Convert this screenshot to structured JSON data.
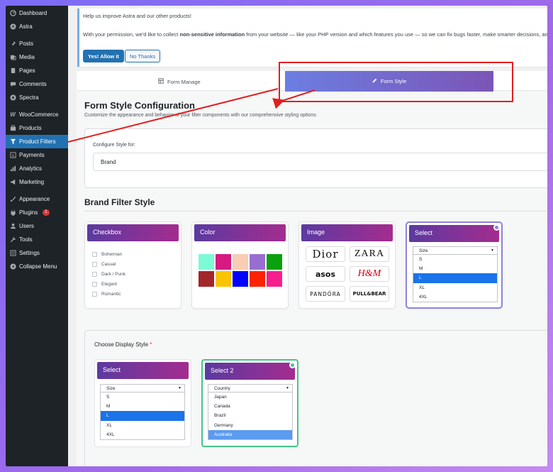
{
  "sidebar": {
    "items": [
      {
        "label": "Dashboard",
        "icon": "dashboard-icon"
      },
      {
        "label": "Astra",
        "icon": "astra-icon"
      },
      {
        "label": "Posts",
        "icon": "pin-icon"
      },
      {
        "label": "Media",
        "icon": "media-icon"
      },
      {
        "label": "Pages",
        "icon": "pages-icon"
      },
      {
        "label": "Comments",
        "icon": "comments-icon"
      },
      {
        "label": "Spectra",
        "icon": "spectra-icon"
      },
      {
        "label": "WooCommerce",
        "icon": "woocommerce-icon"
      },
      {
        "label": "Products",
        "icon": "products-icon"
      },
      {
        "label": "Product Filters",
        "icon": "filter-icon"
      },
      {
        "label": "Payments",
        "icon": "payments-icon"
      },
      {
        "label": "Analytics",
        "icon": "analytics-icon"
      },
      {
        "label": "Marketing",
        "icon": "marketing-icon"
      },
      {
        "label": "Appearance",
        "icon": "appearance-icon"
      },
      {
        "label": "Plugins",
        "icon": "plugins-icon",
        "badge": "1"
      },
      {
        "label": "Users",
        "icon": "users-icon"
      },
      {
        "label": "Tools",
        "icon": "tools-icon"
      },
      {
        "label": "Settings",
        "icon": "settings-icon"
      },
      {
        "label": "Collapse Menu",
        "icon": "collapse-icon"
      }
    ]
  },
  "notice": {
    "title": "Help us improve Astra and our other products!",
    "body_pre": "With your permission, we'd like to collect ",
    "body_bold": "non-sensitive information",
    "body_post": " from your website — like your PHP version and which features you use — so we can fix bugs faster, make smarter decisions, and build feat",
    "allow_label": "Yes! Allow it",
    "decline_label": "No Thanks"
  },
  "tabs": {
    "manage": "Form Manage",
    "style": "Form Style"
  },
  "config": {
    "title": "Form Style Configuration",
    "subtitle": "Customize the appearance and behavior of your filter components with our comprehensive styling options",
    "label": "Configure Style for:",
    "selected": "Brand"
  },
  "brand_section": {
    "title": "Brand Filter Style",
    "cards": {
      "checkbox": {
        "title": "Checkbox",
        "options": [
          "Bohemian",
          "Casual",
          "Dark / Punk",
          "Elegant",
          "Romantic"
        ]
      },
      "color": {
        "title": "Color",
        "swatches": [
          "#7dfad6",
          "#d61a7f",
          "#f9cdb4",
          "#9a6dd1",
          "#0aa10f",
          "#a3262a",
          "#fbc400",
          "#0000ff",
          "#ff2400",
          "#f71f8e"
        ]
      },
      "image": {
        "title": "Image",
        "brands": [
          "Dior",
          "ZARA",
          "asos",
          "H&M",
          "PANDÖRA",
          "PULL&BEAR"
        ]
      },
      "select": {
        "title": "Select",
        "header": "Size",
        "options": [
          "S",
          "M",
          "L",
          "XL",
          "4XL"
        ],
        "selected": "L"
      }
    }
  },
  "display": {
    "label": "Choose Display Style",
    "required": "*",
    "select": {
      "title": "Select",
      "header": "Size",
      "options": [
        "S",
        "M",
        "L",
        "XL",
        "4XL"
      ],
      "selected": "L"
    },
    "select2": {
      "title": "Select 2",
      "header": "Country",
      "options": [
        "Japan",
        "Canada",
        "Brazil",
        "Germany",
        "Australia"
      ],
      "selected": "Australia"
    }
  },
  "colors": {
    "sidebar_bg": "#1d2327",
    "wp_blue": "#2271b1",
    "annotation_red": "#e02020",
    "selected_blue": "#1a73e8"
  }
}
